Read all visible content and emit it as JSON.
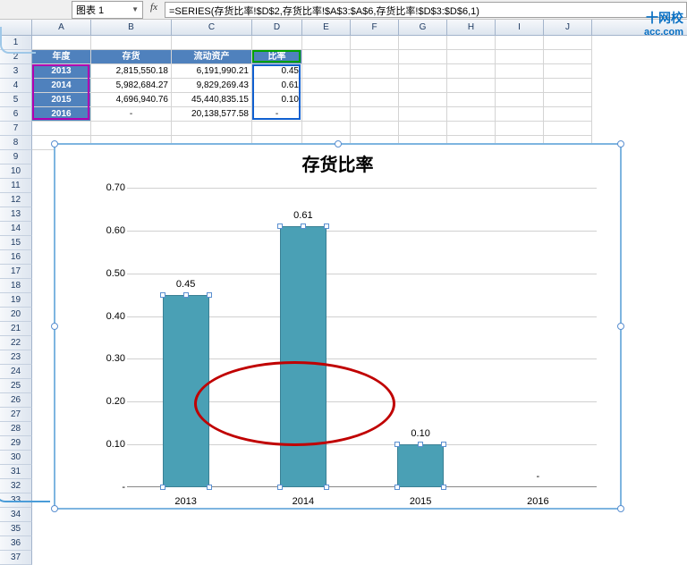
{
  "formula_bar": {
    "name_box": "图表 1",
    "fx": "fx",
    "formula": "=SERIES(存货比率!$D$2,存货比率!$A$3:$A$6,存货比率!$D$3:$D$6,1)"
  },
  "columns": [
    "A",
    "B",
    "C",
    "D",
    "E",
    "F",
    "G",
    "H",
    "I",
    "J"
  ],
  "row_numbers": [
    "1",
    "2",
    "3",
    "4",
    "5",
    "6",
    "7",
    "8",
    "9",
    "10",
    "11",
    "12",
    "13",
    "14",
    "15",
    "16",
    "17",
    "18",
    "19",
    "20",
    "21",
    "22",
    "23",
    "24",
    "25",
    "26",
    "27",
    "28",
    "29",
    "30",
    "31",
    "32",
    "33",
    "34",
    "35",
    "36",
    "37"
  ],
  "table": {
    "headers": {
      "year": "年度",
      "inventory": "存货",
      "current_assets": "流动资产",
      "ratio": "比率"
    },
    "rows": [
      {
        "year": "2013",
        "inventory": "2,815,550.18",
        "current_assets": "6,191,990.21",
        "ratio": "0.45"
      },
      {
        "year": "2014",
        "inventory": "5,982,684.27",
        "current_assets": "9,829,269.43",
        "ratio": "0.61"
      },
      {
        "year": "2015",
        "inventory": "4,696,940.76",
        "current_assets": "45,440,835.15",
        "ratio": "0.10"
      },
      {
        "year": "2016",
        "inventory": "-",
        "current_assets": "20,138,577.58",
        "ratio": "-"
      }
    ]
  },
  "chart_data": {
    "type": "bar",
    "title": "存货比率",
    "categories": [
      "2013",
      "2014",
      "2015",
      "2016"
    ],
    "values": [
      0.45,
      0.61,
      0.1,
      null
    ],
    "data_labels": [
      "0.45",
      "0.61",
      "0.10",
      "-"
    ],
    "ylabel": "",
    "xlabel": "",
    "ylim": [
      0,
      0.7
    ],
    "yticks": [
      "-",
      "0.10",
      "0.20",
      "0.30",
      "0.40",
      "0.50",
      "0.60",
      "0.70"
    ],
    "bar_color": "#4aa0b5",
    "annotation": {
      "type": "ellipse",
      "approx_center": [
        0.35,
        0.22
      ]
    }
  },
  "watermark": {
    "line1": "十网校",
    "line2": "acc.com"
  }
}
